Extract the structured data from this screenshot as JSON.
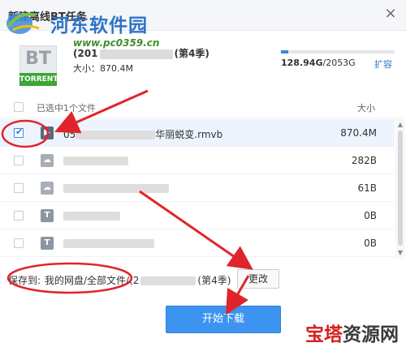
{
  "dialog": {
    "title": "新建离线BT任务",
    "close_glyph": "×"
  },
  "watermark": {
    "site_name": "河东软件园",
    "url": "www.pc0359.cn"
  },
  "task": {
    "icon_text": "BT",
    "icon_label": "TORRENT",
    "name_prefix": "(201",
    "name_suffix": "(第4季)",
    "size_text": "大小：870.4M"
  },
  "quota": {
    "used": "128.94G",
    "total": "/2053G",
    "used_fraction": 0.063,
    "expand_label": "扩容"
  },
  "list_header": {
    "selected_text": "已选中1个文件",
    "size_header": "大小"
  },
  "files": [
    {
      "name_prefix": "05",
      "name_suffix": "华丽蜕变.rmvb",
      "size": "870.4M",
      "type": "video",
      "checked": true
    },
    {
      "name_prefix": "",
      "name_suffix": "",
      "size": "282B",
      "type": "img",
      "checked": false
    },
    {
      "name_prefix": "",
      "name_suffix": "",
      "size": "61B",
      "type": "img",
      "checked": false
    },
    {
      "name_prefix": "",
      "name_suffix": "",
      "size": "0B",
      "type": "txt",
      "checked": false
    },
    {
      "name_prefix": "",
      "name_suffix": "",
      "size": "0B",
      "type": "txt",
      "checked": false
    }
  ],
  "save": {
    "label": "保存到:",
    "path_prefix": "我的网盘/全部文件/(2",
    "path_suffix": "(第4季)",
    "change_button": "更改"
  },
  "start_button": "开始下载",
  "brand": {
    "part1": "宝塔",
    "part2": "资源网"
  },
  "colors": {
    "accent": "#3c93f0",
    "annotation": "#e0242b",
    "brand_red": "#d71f1f"
  }
}
